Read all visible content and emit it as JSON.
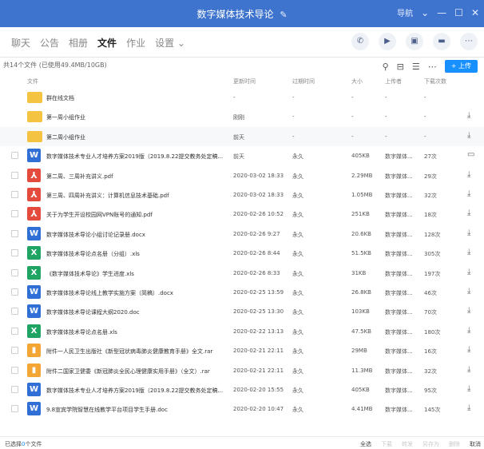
{
  "window": {
    "title": "数字媒体技术导论",
    "edit_icon": "✎",
    "right_label": "导航",
    "controls": {
      "dropdown": "⌄",
      "minimize": "—",
      "maximize": "☐",
      "close": "✕"
    }
  },
  "tabs": [
    {
      "label": "聊天",
      "active": false
    },
    {
      "label": "公告",
      "active": false
    },
    {
      "label": "相册",
      "active": false
    },
    {
      "label": "文件",
      "active": true
    },
    {
      "label": "作业",
      "active": false
    },
    {
      "label": "设置 ⌄",
      "active": false
    }
  ],
  "tab_actions": [
    {
      "name": "phone-icon",
      "glyph": "✆"
    },
    {
      "name": "video-icon",
      "glyph": "▶"
    },
    {
      "name": "screen-share-icon",
      "glyph": "▣"
    },
    {
      "name": "chat-icon",
      "glyph": "▬"
    },
    {
      "name": "more-icon",
      "glyph": "⋯"
    }
  ],
  "info": {
    "summary": "共14个文件 (已使用49.4MB/10GB)",
    "upload_label": "+ 上传",
    "tools": {
      "search": "⚲",
      "folder": "⊟",
      "list": "☰",
      "more": "⋯"
    }
  },
  "columns": {
    "name": "文件",
    "time": "更新时间",
    "expire": "过期时间",
    "size": "大小",
    "uploader": "上传者",
    "downloads": "下载次数"
  },
  "rows": [
    {
      "type": "folder",
      "name": "群在线文档",
      "time": "-",
      "expire": "-",
      "size": "-",
      "uploader": "-",
      "downloads": "-",
      "action": "",
      "highlight": false,
      "checkbox": false
    },
    {
      "type": "folder",
      "name": "第一周小组作业",
      "time": "刚刚",
      "expire": "-",
      "size": "-",
      "uploader": "-",
      "downloads": "-",
      "action": "⤓",
      "highlight": false,
      "checkbox": false
    },
    {
      "type": "folder",
      "name": "第二周小组作业",
      "time": "前天",
      "expire": "-",
      "size": "-",
      "uploader": "-",
      "downloads": "-",
      "action": "⤓",
      "highlight": true,
      "checkbox": false
    },
    {
      "type": "word",
      "name": "数字媒体技术专业人才培养方案2019版（2019.8.22提交教务处定稿...",
      "time": "前天",
      "expire": "永久",
      "size": "405KB",
      "uploader": "数字媒体...",
      "downloads": "27次",
      "action": "▭",
      "highlight": false,
      "checkbox": true
    },
    {
      "type": "pdf",
      "name": "第二周、三周补充讲义.pdf",
      "time": "2020-03-02 18:33",
      "expire": "永久",
      "size": "2.29MB",
      "uploader": "数字媒体...",
      "downloads": "29次",
      "action": "⤓",
      "highlight": false,
      "checkbox": true
    },
    {
      "type": "pdf",
      "name": "第三周、四周补充讲义：计算机信息技术基础.pdf",
      "time": "2020-03-02 18:33",
      "expire": "永久",
      "size": "1.05MB",
      "uploader": "数字媒体...",
      "downloads": "32次",
      "action": "⤓",
      "highlight": false,
      "checkbox": true
    },
    {
      "type": "pdf",
      "name": "关于为学生开设校园网VPN账号的通知.pdf",
      "time": "2020-02-26 10:52",
      "expire": "永久",
      "size": "251KB",
      "uploader": "数字媒体...",
      "downloads": "18次",
      "action": "⤓",
      "highlight": false,
      "checkbox": true
    },
    {
      "type": "word",
      "name": "数字媒体技术导论小组讨论记录册.docx",
      "time": "2020-02-26 9:27",
      "expire": "永久",
      "size": "20.6KB",
      "uploader": "数字媒体...",
      "downloads": "128次",
      "action": "⤓",
      "highlight": false,
      "checkbox": true
    },
    {
      "type": "excel",
      "name": "数字媒体技术导论点名册（分组）.xls",
      "time": "2020-02-26 8:44",
      "expire": "永久",
      "size": "51.5KB",
      "uploader": "数字媒体...",
      "downloads": "305次",
      "action": "⤓",
      "highlight": false,
      "checkbox": true
    },
    {
      "type": "excel",
      "name": "《数字媒体技术导论》学生进度.xls",
      "time": "2020-02-26 8:33",
      "expire": "永久",
      "size": "31KB",
      "uploader": "数字媒体...",
      "downloads": "197次",
      "action": "⤓",
      "highlight": false,
      "checkbox": true
    },
    {
      "type": "word",
      "name": "数字媒体技术导论线上教学实施方案（简稿）.docx",
      "time": "2020-02-25 13:59",
      "expire": "永久",
      "size": "26.8KB",
      "uploader": "数字媒体...",
      "downloads": "46次",
      "action": "⤓",
      "highlight": false,
      "checkbox": true
    },
    {
      "type": "word",
      "name": "数字媒体技术导论课程大纲2020.doc",
      "time": "2020-02-25 13:30",
      "expire": "永久",
      "size": "103KB",
      "uploader": "数字媒体...",
      "downloads": "70次",
      "action": "⤓",
      "highlight": false,
      "checkbox": true
    },
    {
      "type": "excel",
      "name": "数字媒体技术导论点名册.xls",
      "time": "2020-02-22 13:13",
      "expire": "永久",
      "size": "47.5KB",
      "uploader": "数字媒体...",
      "downloads": "180次",
      "action": "⤓",
      "highlight": false,
      "checkbox": true
    },
    {
      "type": "rar",
      "name": "附件一人民卫生出版社《新型冠状病毒肺炎健康教育手册》全文.rar",
      "time": "2020-02-21 22:11",
      "expire": "永久",
      "size": "29MB",
      "uploader": "数字媒体...",
      "downloads": "16次",
      "action": "⤓",
      "highlight": false,
      "checkbox": true
    },
    {
      "type": "rar",
      "name": "附件二国家卫健委《新冠肺炎全民心理健康实用手册》（全文）.rar",
      "time": "2020-02-21 22:11",
      "expire": "永久",
      "size": "11.3MB",
      "uploader": "数字媒体...",
      "downloads": "32次",
      "action": "⤓",
      "highlight": false,
      "checkbox": true
    },
    {
      "type": "word",
      "name": "数字媒体技术专业人才培养方案2019版（2019.8.22提交教务处定稿...",
      "time": "2020-02-20 15:55",
      "expire": "永久",
      "size": "405KB",
      "uploader": "数字媒体...",
      "downloads": "95次",
      "action": "⤓",
      "highlight": false,
      "checkbox": true
    },
    {
      "type": "word",
      "name": "9.8宣宾学院智慧在线教学平台项目学生手册.doc",
      "time": "2020-02-20 10:47",
      "expire": "永久",
      "size": "4.41MB",
      "uploader": "数字媒体...",
      "downloads": "145次",
      "action": "⤓",
      "highlight": false,
      "checkbox": true
    }
  ],
  "icons": {
    "word": "W",
    "pdf": "⅄",
    "excel": "X",
    "rar": "▮",
    "folder": ""
  },
  "footer": {
    "selected_prefix": "已选择",
    "selected_count": "0",
    "selected_suffix": "个文件",
    "buttons": [
      {
        "label": "全选",
        "enabled": true
      },
      {
        "label": "下载",
        "enabled": false
      },
      {
        "label": "转发",
        "enabled": false
      },
      {
        "label": "另存为",
        "enabled": false
      },
      {
        "label": "删除",
        "enabled": false
      },
      {
        "label": "取消",
        "enabled": true
      }
    ]
  }
}
